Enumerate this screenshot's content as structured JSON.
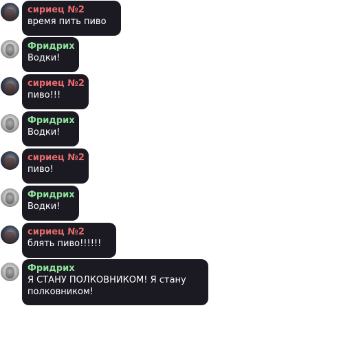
{
  "messages": [
    {
      "sender": "сириец №2",
      "text": "время пить пиво"
    },
    {
      "sender": "Фридрих",
      "text": "Водки!"
    },
    {
      "sender": "сириец №2",
      "text": "пиво!!!"
    },
    {
      "sender": "Фридрих",
      "text": "Водки!"
    },
    {
      "sender": "сириец №2",
      "text": "пиво!"
    },
    {
      "sender": "Фридрих",
      "text": "Водки!"
    },
    {
      "sender": "сириец №2",
      "text": "блять пиво!!!!!!"
    },
    {
      "sender": "Фридрих",
      "text": "Я СТАНУ ПОЛКОВНИКОМ! Я стану\nполковником!"
    }
  ],
  "colors": {
    "bubble_bg": "#1b1a23",
    "sender_syriets": "#e86b6b",
    "sender_fridrih": "#8fe39a",
    "message_text": "#ffffff"
  }
}
